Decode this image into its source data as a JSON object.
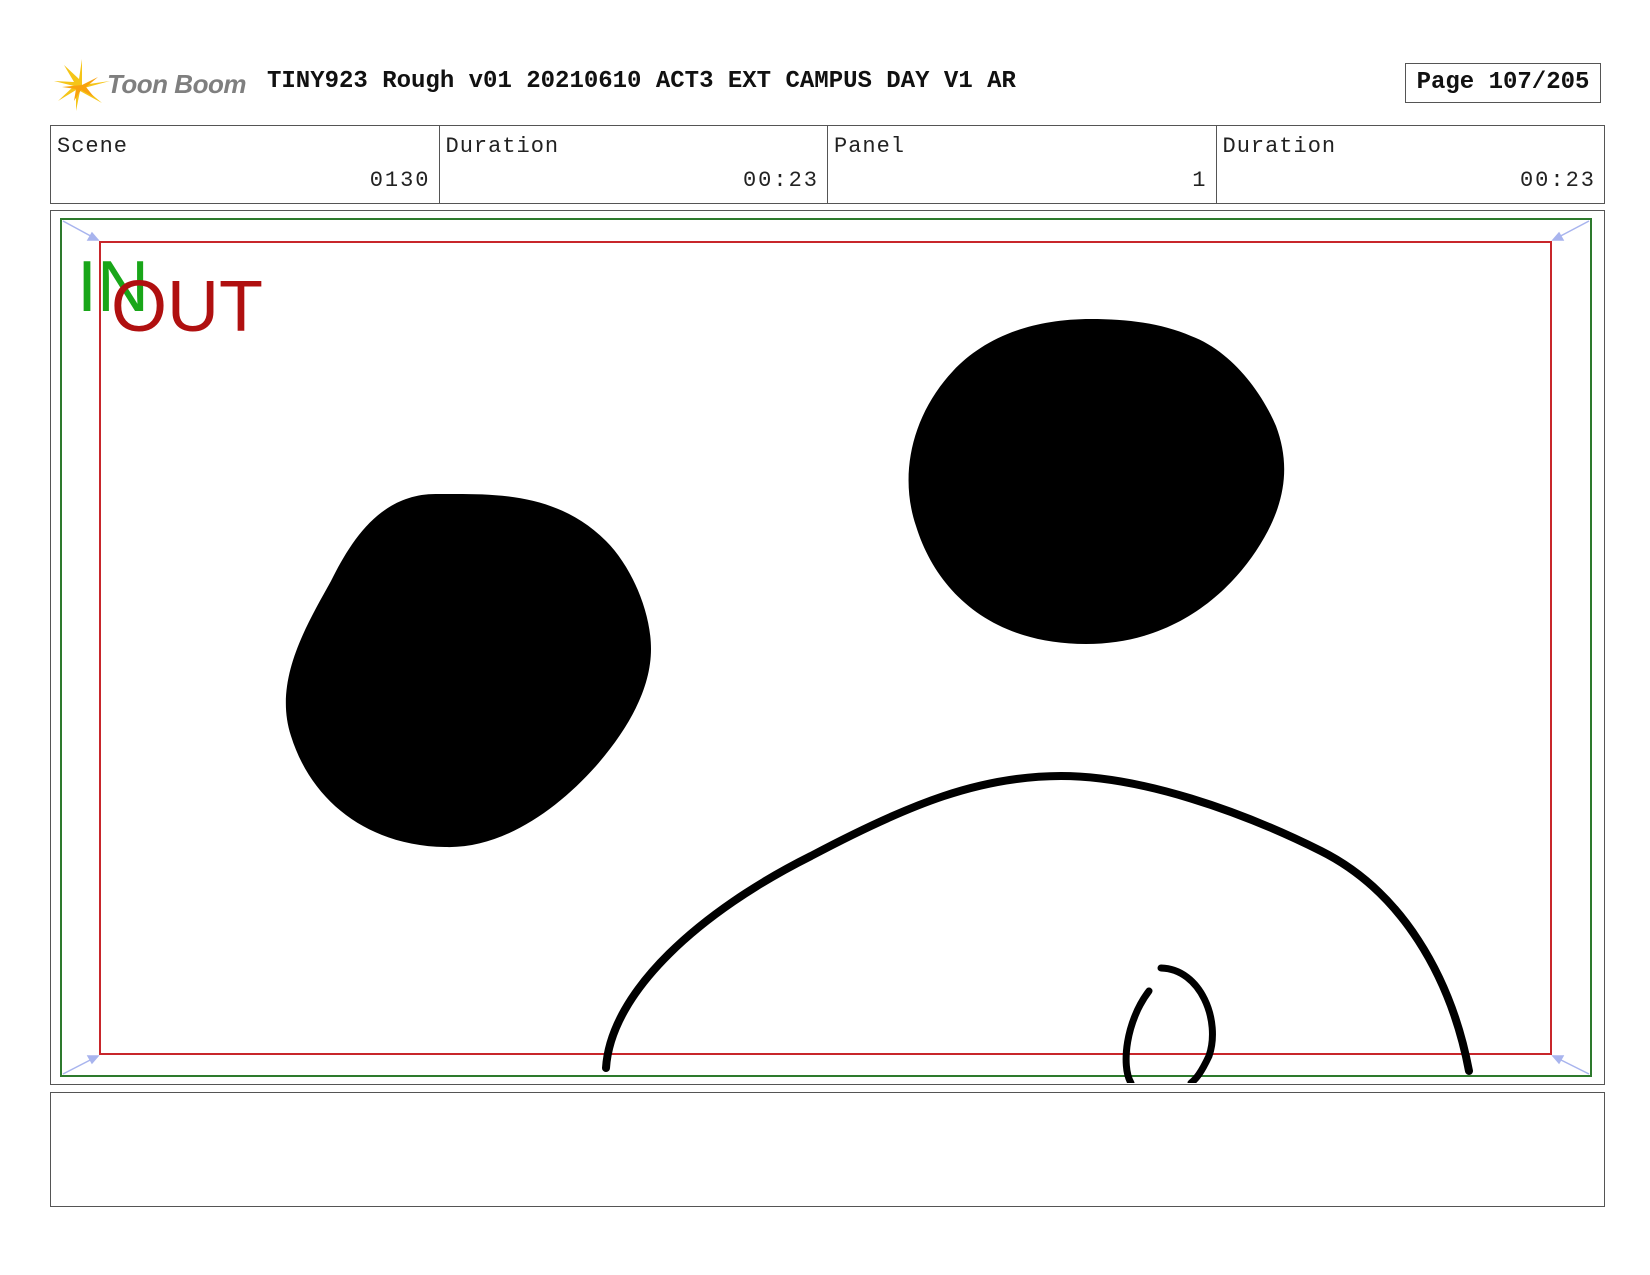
{
  "header": {
    "logo_text": "Toon Boom",
    "title": "TINY923 Rough v01 20210610 ACT3 EXT CAMPUS DAY V1 AR",
    "page": "Page 107/205"
  },
  "info": [
    {
      "label": "Scene",
      "value": "0130"
    },
    {
      "label": "Duration",
      "value": "00:23"
    },
    {
      "label": "Panel",
      "value": "1"
    },
    {
      "label": "Duration",
      "value": "00:23"
    }
  ],
  "panel": {
    "in_label": "IN",
    "out_label": "OUT",
    "colors": {
      "in": "#19a619",
      "out": "#b01010",
      "safe_frame": "#c8262b",
      "outer_frame": "#2d7a2d",
      "corner_arrows": "#a8b4ee",
      "ink": "#000000"
    }
  },
  "notes": {
    "text": ""
  }
}
